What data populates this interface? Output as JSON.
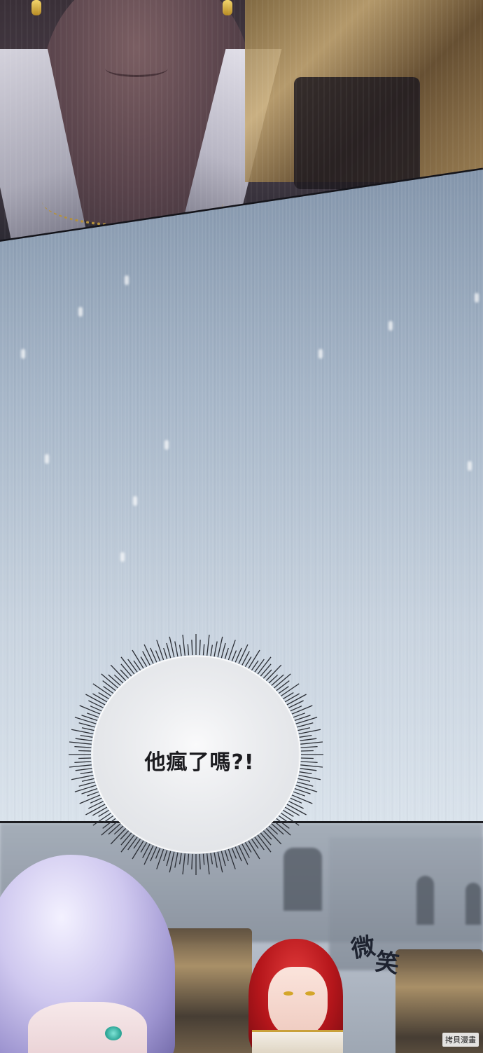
{
  "panels": {
    "top": {
      "description_visible_text": ""
    },
    "middle": {
      "bubble_text": "他瘋了嗎?!"
    },
    "bottom": {
      "sfx_chars": [
        "微",
        "笑"
      ]
    }
  },
  "watermark": "拷貝漫畫",
  "colors": {
    "rain_panel_top": "#8395ab",
    "rain_panel_bottom": "#d9e2eb",
    "bubble_fill": "#f0f1f3",
    "text_dark": "#1b1b1f",
    "hair_red": "#b5161b",
    "hair_silver": "#cfc8ef"
  }
}
